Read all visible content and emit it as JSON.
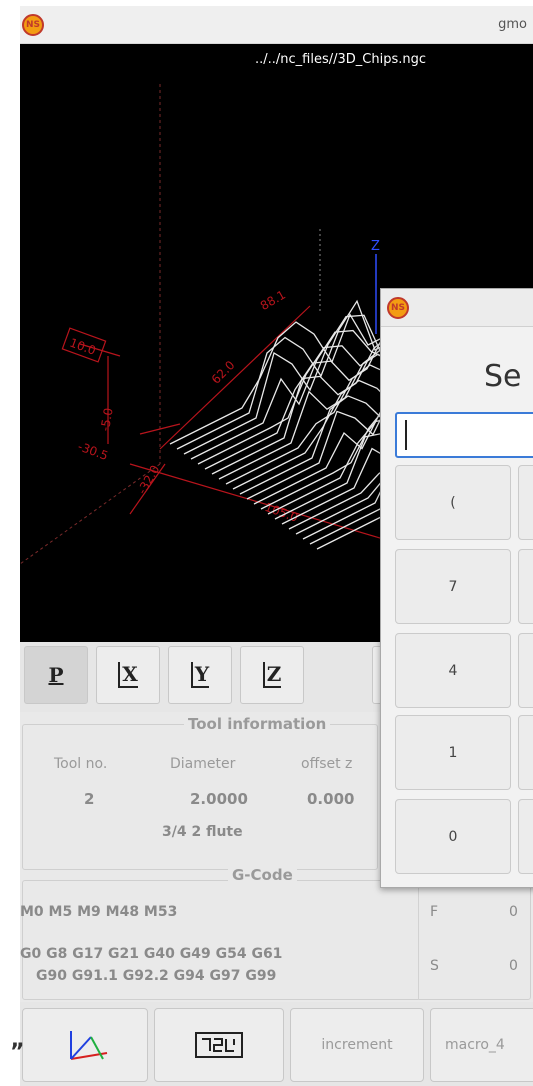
{
  "window": {
    "title": "gmo"
  },
  "viewport": {
    "file_path": "../../nc_files//3D_Chips.ngc",
    "z_axis_label": "Z",
    "dimension_labels": [
      "10.0",
      "-5.0",
      "-30.5",
      "-32.0",
      "105.0",
      "62.0",
      "88.1"
    ]
  },
  "view_buttons": [
    {
      "label": "P",
      "name": "view-p-button",
      "active": true
    },
    {
      "label": "X",
      "name": "view-x-button",
      "active": false
    },
    {
      "label": "Y",
      "name": "view-y-button",
      "active": false
    },
    {
      "label": "Z",
      "name": "view-z-button",
      "active": false
    }
  ],
  "tool_info": {
    "title": "Tool information",
    "headers": [
      "Tool no.",
      "Diameter",
      "offset z"
    ],
    "values": [
      "2",
      "2.0000",
      "0.000"
    ],
    "description": "3/4 2 flute"
  },
  "gcode": {
    "title": "G-Code",
    "line1": "M0 M5 M9 M48 M53",
    "line2": "G0 G8 G17 G21 G40 G49 G54 G61",
    "line3": "G90 G91.1 G92.2 G94 G97 G99",
    "f_label": "F",
    "f_value": "0",
    "s_label": "S",
    "s_value": "0"
  },
  "bottom_buttons": {
    "increment_label": "increment",
    "macro_label": "macro_4"
  },
  "dialog": {
    "heading": "Se",
    "keys": [
      "(",
      "7",
      "4",
      "1",
      "0"
    ]
  },
  "colors": {
    "viewport_bg": "#000000",
    "toolpath": "#ffffff",
    "dimension": "#b8141c",
    "axis_z": "#2f4dff",
    "input_focus": "#3b7bd8"
  },
  "stray_text": "”"
}
